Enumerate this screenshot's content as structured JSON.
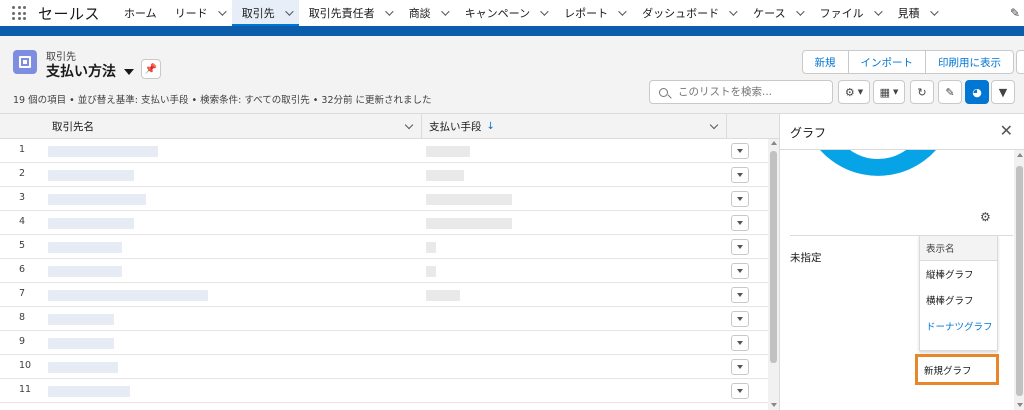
{
  "topnav": {
    "app_name": "セールス",
    "items": [
      {
        "label": "ホーム",
        "has_menu": false,
        "active": false
      },
      {
        "label": "リード",
        "has_menu": true,
        "active": false
      },
      {
        "label": "取引先",
        "has_menu": true,
        "active": true
      },
      {
        "label": "取引先責任者",
        "has_menu": true,
        "active": false
      },
      {
        "label": "商談",
        "has_menu": true,
        "active": false
      },
      {
        "label": "キャンペーン",
        "has_menu": true,
        "active": false
      },
      {
        "label": "レポート",
        "has_menu": true,
        "active": false
      },
      {
        "label": "ダッシュボード",
        "has_menu": true,
        "active": false
      },
      {
        "label": "ケース",
        "has_menu": true,
        "active": false
      },
      {
        "label": "ファイル",
        "has_menu": true,
        "active": false
      },
      {
        "label": "見積",
        "has_menu": true,
        "active": false
      }
    ]
  },
  "header": {
    "object_label": "取引先",
    "list_view_name": "支払い方法",
    "meta": "19 個の項目 • 並び替え基準: 支払い手段 • 検索条件: すべての取引先 • 32分前 に更新されました",
    "buttons": {
      "new": "新規",
      "import": "インポート",
      "print": "印刷用に表示"
    },
    "search_placeholder": "このリストを検索..."
  },
  "table": {
    "columns": [
      "取引先名",
      "支払い手段"
    ],
    "row_numbers": [
      "1",
      "2",
      "3",
      "4",
      "5",
      "6",
      "7",
      "8",
      "9",
      "10",
      "11"
    ]
  },
  "chart_panel": {
    "title": "グラフ",
    "legend_label": "未指定",
    "menu_header": "表示名",
    "menu_items": [
      "縦棒グラフ",
      "横棒グラフ",
      "ドーナツグラフ"
    ],
    "new_chart": "新規グラフ"
  },
  "colors": {
    "brand_band": "#0b5cab",
    "accent": "#0176d3",
    "donut": "#06a3e6",
    "highlight_box": "#e8862a"
  }
}
